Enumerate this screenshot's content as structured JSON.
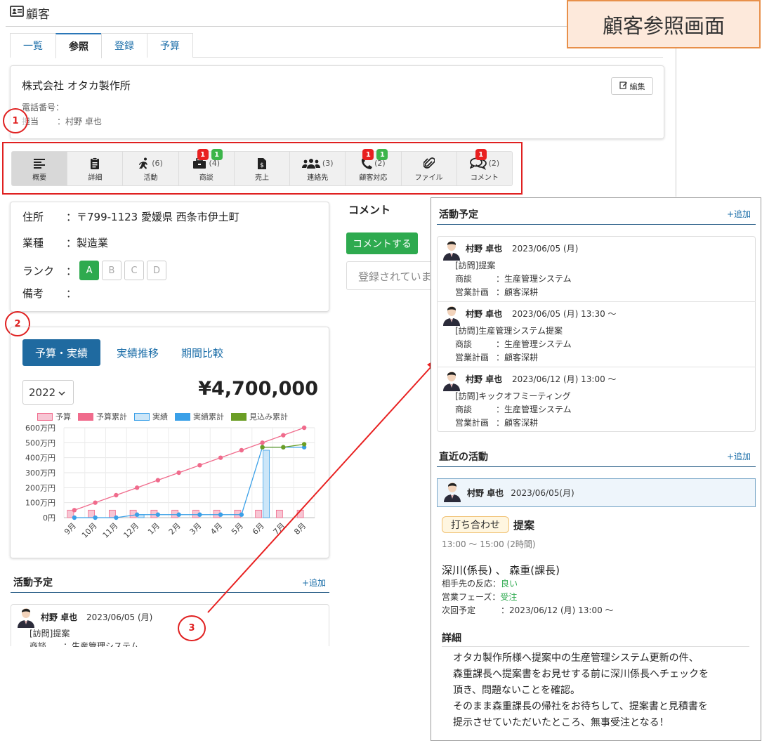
{
  "header": {
    "title": "顧客"
  },
  "callout_title": "顧客参照画面",
  "tabs": [
    "一覧",
    "参照",
    "登録",
    "予算"
  ],
  "customer": {
    "name": "株式会社 オタカ製作所",
    "edit_label": "編集",
    "phone_label": "電話番号",
    "phone_value": "：",
    "owner_label": "担当",
    "owner_value": "：村野 卓也"
  },
  "markers": [
    "1",
    "2",
    "3"
  ],
  "iconbar": [
    {
      "label": "概要",
      "count": "",
      "red": "",
      "green": ""
    },
    {
      "label": "詳細",
      "count": "",
      "red": "",
      "green": ""
    },
    {
      "label": "活動",
      "count": "(6)",
      "red": "",
      "green": ""
    },
    {
      "label": "商談",
      "count": "(4)",
      "red": "1",
      "green": "1"
    },
    {
      "label": "売上",
      "count": "",
      "red": "",
      "green": ""
    },
    {
      "label": "連絡先",
      "count": "(3)",
      "red": "",
      "green": ""
    },
    {
      "label": "顧客対応",
      "count": "(2)",
      "red": "1",
      "green": "1"
    },
    {
      "label": "ファイル",
      "count": "",
      "red": "",
      "green": ""
    },
    {
      "label": "コメント",
      "count": "(2)",
      "red": "1",
      "green": ""
    }
  ],
  "info": {
    "address_label": "住所",
    "address_value": "：〒799-1123 愛媛県 西条市伊土町",
    "industry_label": "業種",
    "industry_value": "：製造業",
    "rank_label": "ランク",
    "rank_sep": "：",
    "ranks": [
      "A",
      "B",
      "C",
      "D"
    ],
    "rank_selected": "A",
    "note_label": "備考",
    "note_value": "："
  },
  "comment": {
    "title": "コメント",
    "button": "コメントする",
    "empty_text": "登録されていません"
  },
  "budget": {
    "tabs": [
      "予算・実績",
      "実績推移",
      "期間比較"
    ],
    "year": "2022",
    "amount": "¥4,700,000"
  },
  "chart_data": {
    "type": "bar",
    "categories": [
      "9月",
      "10月",
      "11月",
      "12月",
      "1月",
      "2月",
      "3月",
      "4月",
      "5月",
      "6月",
      "7月",
      "8月"
    ],
    "ylim": [
      0,
      600
    ],
    "yticks": [
      "0円",
      "100万円",
      "200万円",
      "300万円",
      "400万円",
      "500万円",
      "600万円"
    ],
    "legend": "top",
    "grid": true,
    "series": [
      {
        "name": "予算",
        "type": "bar",
        "color": "#f7c6d4",
        "values": [
          50,
          50,
          50,
          50,
          50,
          50,
          50,
          50,
          50,
          50,
          50,
          50
        ]
      },
      {
        "name": "予算累計",
        "type": "line",
        "color": "#f06b8c",
        "values": [
          50,
          100,
          150,
          200,
          250,
          300,
          350,
          400,
          450,
          500,
          550,
          600
        ]
      },
      {
        "name": "実績",
        "type": "bar",
        "color": "#cce6f8",
        "values": [
          0,
          0,
          0,
          20,
          0,
          0,
          0,
          0,
          0,
          450,
          0,
          0
        ]
      },
      {
        "name": "実績累計",
        "type": "line",
        "color": "#3aa0e8",
        "values": [
          0,
          0,
          0,
          20,
          20,
          20,
          20,
          20,
          20,
          470,
          470,
          470
        ]
      },
      {
        "name": "見込み累計",
        "type": "line",
        "color": "#6b9e25",
        "values": [
          null,
          null,
          null,
          null,
          null,
          null,
          null,
          null,
          null,
          470,
          470,
          490
        ]
      }
    ]
  },
  "left_schedule": {
    "title": "活動予定",
    "add": "+追加",
    "user": "村野 卓也",
    "date": "2023/06/05 (月)",
    "line1": "[訪問]提案",
    "line2": "商談　　：生産管理システム"
  },
  "popup": {
    "schedule_title": "活動予定",
    "add": "+追加",
    "entries": [
      {
        "user": "村野 卓也",
        "date": "2023/06/05 (月)",
        "type": "[訪問]提案",
        "deal_label": "商談",
        "deal_value": "：生産管理システム",
        "plan_label": "営業計画",
        "plan_value": "：顧客深耕"
      },
      {
        "user": "村野 卓也",
        "date": "2023/06/05 (月) 13:30 ～",
        "type": "[訪問]生産管理システム提案",
        "deal_label": "商談",
        "deal_value": "：生産管理システム",
        "plan_label": "営業計画",
        "plan_value": "：顧客深耕"
      },
      {
        "user": "村野 卓也",
        "date": "2023/06/12 (月) 13:00 ～",
        "type": "[訪問]キックオフミーティング",
        "deal_label": "商談",
        "deal_value": "：生産管理システム",
        "plan_label": "営業計画",
        "plan_value": "：顧客深耕"
      }
    ],
    "recent_title": "直近の活動",
    "recent": {
      "user": "村野 卓也",
      "date": "2023/06/05(月)",
      "pill": "打ち合わせ",
      "activity": "提案",
      "time": "13:00 ～ 15:00 (2時間)",
      "people": "深川(係長) 、 森重(課長)",
      "reaction_label": "相手先の反応：",
      "reaction_value": "良い",
      "phase_label": "営業フェーズ：",
      "phase_value": "受注",
      "next_label": "次回予定",
      "next_value": "：2023/06/12 (月) 13:00 ～"
    },
    "detail_title": "詳細",
    "detail_lines": [
      "オタカ製作所様へ提案中の生産管理システム更新の件、",
      "森重課長へ提案書をお見せする前に深川係長へチェックを",
      "頂き、問題ないことを確認。",
      "そのまま森重課長の帰社をお待ちして、提案書と見積書を",
      "提示させていただいたところ、無事受注となる！"
    ]
  }
}
